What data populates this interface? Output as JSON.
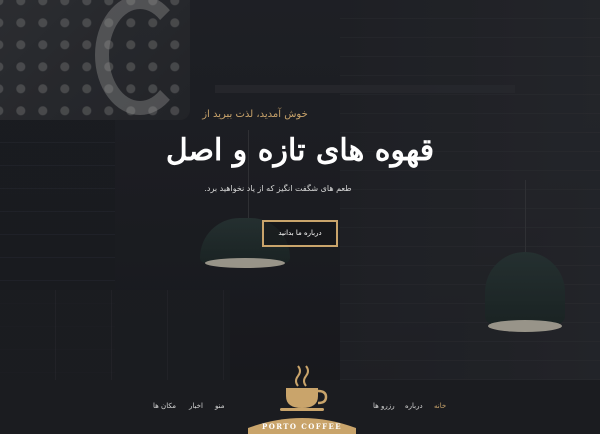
{
  "hero": {
    "welcome": "خوش آمدید، لذت ببرید از",
    "headline": "قهوه های تازه و اصل",
    "subline": "طعم های شگفت انگیز که از یاد نخواهید برد.",
    "cta_label": "درباره ما بدانید"
  },
  "nav": {
    "items": [
      {
        "label": "خانه",
        "active": true
      },
      {
        "label": "درباره"
      },
      {
        "label": "رزرو ها"
      },
      {
        "label": "منو"
      },
      {
        "label": "اخبار"
      },
      {
        "label": "مکان ها"
      }
    ]
  },
  "logo": {
    "text": "PORTO COFFEE",
    "icon": "coffee-cup-icon"
  },
  "colors": {
    "accent": "#c9a46b",
    "background": "#1b1c20",
    "text": "#ffffff"
  }
}
